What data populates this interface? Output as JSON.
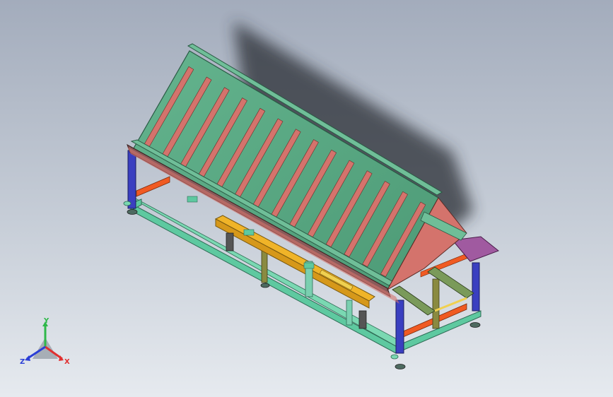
{
  "view": {
    "triad": {
      "x_label": "X",
      "y_label": "Y",
      "z_label": "Z",
      "x_color": "#e03030",
      "y_color": "#2fb84a",
      "z_color": "#2b3fd6"
    }
  },
  "model": {
    "chute_color": "#5aa882",
    "slat_color": "#d4736c",
    "frame_color": "#5ec9a0",
    "post_color": "#3a3fc0",
    "crossbar_color": "#f05a22",
    "table_color": "#f0b428",
    "plate_color": "#a05aa0",
    "shadow_color": "#2c2f36",
    "slat_count": 14
  }
}
